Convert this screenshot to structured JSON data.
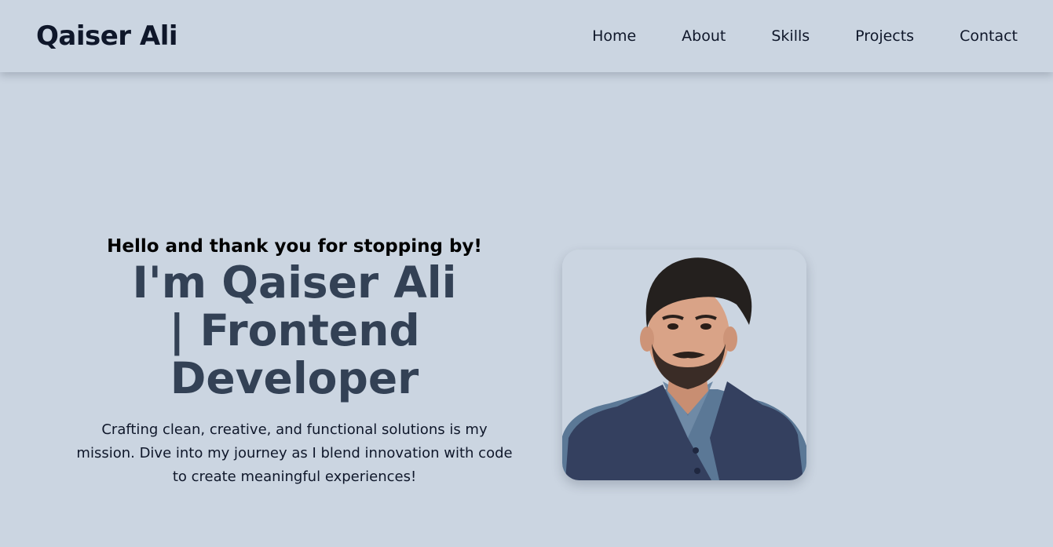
{
  "nav": {
    "brand": "Qaiser Ali",
    "links": [
      {
        "label": "Home"
      },
      {
        "label": "About"
      },
      {
        "label": "Skills"
      },
      {
        "label": "Projects"
      },
      {
        "label": "Contact"
      }
    ]
  },
  "hero": {
    "greeting": "Hello and thank you for stopping by!",
    "headline": "I'm Qaiser Ali | Frontend Developer",
    "description": "Crafting clean, creative, and functional solutions is my mission. Dive into my journey as I blend innovation with code to create meaningful experiences!"
  },
  "colors": {
    "background": "#cbd5e1",
    "brand_text": "#0f172a",
    "headline": "#334155"
  }
}
